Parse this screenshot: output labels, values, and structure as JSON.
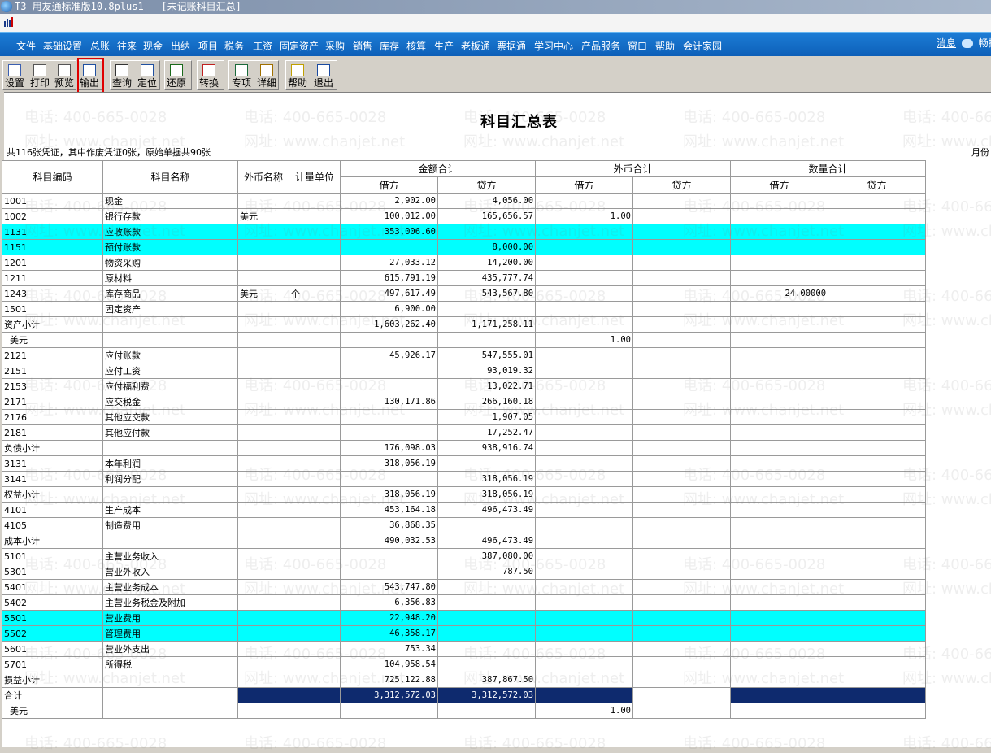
{
  "window": {
    "title": "T3-用友通标准版10.8plus1 - [未记账科目汇总]"
  },
  "menu": [
    "文件",
    "基础设置",
    "总账",
    "往来",
    "现金",
    "出纳",
    "项目",
    "税务",
    "工资",
    "固定资产",
    "采购",
    "销售",
    "库存",
    "核算",
    "生产",
    "老板通",
    "票据通",
    "学习中心",
    "产品服务",
    "窗口",
    "帮助",
    "会计家园"
  ],
  "right_status": {
    "message": "消息",
    "extra": "畅捷"
  },
  "toolbar": [
    {
      "label": "设置",
      "icon": "setup-icon"
    },
    {
      "label": "打印",
      "icon": "print-icon"
    },
    {
      "label": "预览",
      "icon": "preview-icon"
    },
    {
      "label": "输出",
      "icon": "export-icon"
    },
    {
      "label": "查询",
      "icon": "query-icon"
    },
    {
      "label": "定位",
      "icon": "locate-icon"
    },
    {
      "label": "还原",
      "icon": "restore-icon"
    },
    {
      "label": "转换",
      "icon": "convert-icon"
    },
    {
      "label": "专项",
      "icon": "special-icon"
    },
    {
      "label": "详细",
      "icon": "detail-icon"
    },
    {
      "label": "帮助",
      "icon": "help-icon"
    },
    {
      "label": "退出",
      "icon": "exit-icon"
    }
  ],
  "report": {
    "title": "科目汇总表",
    "summary": "共116张凭证，其中作废凭证0张，原始单据共90张",
    "period_label": "月份"
  },
  "watermark": {
    "phone": "电话: 400-665-0028",
    "site": "网址: www.chanjet.net"
  },
  "table": {
    "headers": {
      "code": "科目编码",
      "name": "科目名称",
      "currency": "外币名称",
      "unit": "计量单位",
      "amount_total": "金额合计",
      "fx_total": "外币合计",
      "qty_total": "数量合计",
      "debit": "借方",
      "credit": "贷方"
    },
    "rows": [
      {
        "code": "1001",
        "name": "现金",
        "cur": "",
        "unit": "",
        "dr": "2,902.00",
        "cr": "4,056.00",
        "fdr": "",
        "fcr": "",
        "qdr": "",
        "qcr": "",
        "hl": false
      },
      {
        "code": "1002",
        "name": "银行存款",
        "cur": "美元",
        "unit": "",
        "dr": "100,012.00",
        "cr": "165,656.57",
        "fdr": "1.00",
        "fcr": "",
        "qdr": "",
        "qcr": "",
        "hl": false
      },
      {
        "code": "1131",
        "name": "应收账款",
        "cur": "",
        "unit": "",
        "dr": "353,006.60",
        "cr": "",
        "fdr": "",
        "fcr": "",
        "qdr": "",
        "qcr": "",
        "hl": true
      },
      {
        "code": "1151",
        "name": "预付账款",
        "cur": "",
        "unit": "",
        "dr": "",
        "cr": "8,000.00",
        "fdr": "",
        "fcr": "",
        "qdr": "",
        "qcr": "",
        "hl": true
      },
      {
        "code": "1201",
        "name": "物资采购",
        "cur": "",
        "unit": "",
        "dr": "27,033.12",
        "cr": "14,200.00",
        "fdr": "",
        "fcr": "",
        "qdr": "",
        "qcr": "",
        "hl": false
      },
      {
        "code": "1211",
        "name": "原材料",
        "cur": "",
        "unit": "",
        "dr": "615,791.19",
        "cr": "435,777.74",
        "fdr": "",
        "fcr": "",
        "qdr": "",
        "qcr": "",
        "hl": false
      },
      {
        "code": "1243",
        "name": "库存商品",
        "cur": "美元",
        "unit": "个",
        "dr": "497,617.49",
        "cr": "543,567.80",
        "fdr": "",
        "fcr": "",
        "qdr": "24.00000",
        "qcr": "",
        "hl": false
      },
      {
        "code": "1501",
        "name": "固定资产",
        "cur": "",
        "unit": "",
        "dr": "6,900.00",
        "cr": "",
        "fdr": "",
        "fcr": "",
        "qdr": "",
        "qcr": "",
        "hl": false
      },
      {
        "code": "资产小计",
        "name": "",
        "cur": "",
        "unit": "",
        "dr": "1,603,262.40",
        "cr": "1,171,258.11",
        "fdr": "",
        "fcr": "",
        "qdr": "",
        "qcr": "",
        "hl": false
      },
      {
        "code": "  美元",
        "name": "",
        "cur": "",
        "unit": "",
        "dr": "",
        "cr": "",
        "fdr": "1.00",
        "fcr": "",
        "qdr": "",
        "qcr": "",
        "hl": false
      },
      {
        "code": "2121",
        "name": "应付账款",
        "cur": "",
        "unit": "",
        "dr": "45,926.17",
        "cr": "547,555.01",
        "fdr": "",
        "fcr": "",
        "qdr": "",
        "qcr": "",
        "hl": false
      },
      {
        "code": "2151",
        "name": "应付工资",
        "cur": "",
        "unit": "",
        "dr": "",
        "cr": "93,019.32",
        "fdr": "",
        "fcr": "",
        "qdr": "",
        "qcr": "",
        "hl": false
      },
      {
        "code": "2153",
        "name": "应付福利费",
        "cur": "",
        "unit": "",
        "dr": "",
        "cr": "13,022.71",
        "fdr": "",
        "fcr": "",
        "qdr": "",
        "qcr": "",
        "hl": false
      },
      {
        "code": "2171",
        "name": "应交税金",
        "cur": "",
        "unit": "",
        "dr": "130,171.86",
        "cr": "266,160.18",
        "fdr": "",
        "fcr": "",
        "qdr": "",
        "qcr": "",
        "hl": false
      },
      {
        "code": "2176",
        "name": "其他应交款",
        "cur": "",
        "unit": "",
        "dr": "",
        "cr": "1,907.05",
        "fdr": "",
        "fcr": "",
        "qdr": "",
        "qcr": "",
        "hl": false
      },
      {
        "code": "2181",
        "name": "其他应付款",
        "cur": "",
        "unit": "",
        "dr": "",
        "cr": "17,252.47",
        "fdr": "",
        "fcr": "",
        "qdr": "",
        "qcr": "",
        "hl": false
      },
      {
        "code": "负债小计",
        "name": "",
        "cur": "",
        "unit": "",
        "dr": "176,098.03",
        "cr": "938,916.74",
        "fdr": "",
        "fcr": "",
        "qdr": "",
        "qcr": "",
        "hl": false
      },
      {
        "code": "3131",
        "name": "本年利润",
        "cur": "",
        "unit": "",
        "dr": "318,056.19",
        "cr": "",
        "fdr": "",
        "fcr": "",
        "qdr": "",
        "qcr": "",
        "hl": false
      },
      {
        "code": "3141",
        "name": "利润分配",
        "cur": "",
        "unit": "",
        "dr": "",
        "cr": "318,056.19",
        "fdr": "",
        "fcr": "",
        "qdr": "",
        "qcr": "",
        "hl": false
      },
      {
        "code": "权益小计",
        "name": "",
        "cur": "",
        "unit": "",
        "dr": "318,056.19",
        "cr": "318,056.19",
        "fdr": "",
        "fcr": "",
        "qdr": "",
        "qcr": "",
        "hl": false
      },
      {
        "code": "4101",
        "name": "生产成本",
        "cur": "",
        "unit": "",
        "dr": "453,164.18",
        "cr": "496,473.49",
        "fdr": "",
        "fcr": "",
        "qdr": "",
        "qcr": "",
        "hl": false
      },
      {
        "code": "4105",
        "name": "制造费用",
        "cur": "",
        "unit": "",
        "dr": "36,868.35",
        "cr": "",
        "fdr": "",
        "fcr": "",
        "qdr": "",
        "qcr": "",
        "hl": false
      },
      {
        "code": "成本小计",
        "name": "",
        "cur": "",
        "unit": "",
        "dr": "490,032.53",
        "cr": "496,473.49",
        "fdr": "",
        "fcr": "",
        "qdr": "",
        "qcr": "",
        "hl": false
      },
      {
        "code": "5101",
        "name": "主营业务收入",
        "cur": "",
        "unit": "",
        "dr": "",
        "cr": "387,080.00",
        "fdr": "",
        "fcr": "",
        "qdr": "",
        "qcr": "",
        "hl": false
      },
      {
        "code": "5301",
        "name": "营业外收入",
        "cur": "",
        "unit": "",
        "dr": "",
        "cr": "787.50",
        "fdr": "",
        "fcr": "",
        "qdr": "",
        "qcr": "",
        "hl": false
      },
      {
        "code": "5401",
        "name": "主营业务成本",
        "cur": "",
        "unit": "",
        "dr": "543,747.80",
        "cr": "",
        "fdr": "",
        "fcr": "",
        "qdr": "",
        "qcr": "",
        "hl": false
      },
      {
        "code": "5402",
        "name": "主营业务税金及附加",
        "cur": "",
        "unit": "",
        "dr": "6,356.83",
        "cr": "",
        "fdr": "",
        "fcr": "",
        "qdr": "",
        "qcr": "",
        "hl": false
      },
      {
        "code": "5501",
        "name": "营业费用",
        "cur": "",
        "unit": "",
        "dr": "22,948.20",
        "cr": "",
        "fdr": "",
        "fcr": "",
        "qdr": "",
        "qcr": "",
        "hl": true
      },
      {
        "code": "5502",
        "name": "管理费用",
        "cur": "",
        "unit": "",
        "dr": "46,358.17",
        "cr": "",
        "fdr": "",
        "fcr": "",
        "qdr": "",
        "qcr": "",
        "hl": true
      },
      {
        "code": "5601",
        "name": "营业外支出",
        "cur": "",
        "unit": "",
        "dr": "753.34",
        "cr": "",
        "fdr": "",
        "fcr": "",
        "qdr": "",
        "qcr": "",
        "hl": false
      },
      {
        "code": "5701",
        "name": "所得税",
        "cur": "",
        "unit": "",
        "dr": "104,958.54",
        "cr": "",
        "fdr": "",
        "fcr": "",
        "qdr": "",
        "qcr": "",
        "hl": false
      },
      {
        "code": "损益小计",
        "name": "",
        "cur": "",
        "unit": "",
        "dr": "725,122.88",
        "cr": "387,867.50",
        "fdr": "",
        "fcr": "",
        "qdr": "",
        "qcr": "",
        "hl": false
      },
      {
        "code": "合计",
        "name": "",
        "cur": "",
        "unit": "",
        "dr": "3,312,572.03",
        "cr": "3,312,572.03",
        "fdr": "",
        "fcr": "",
        "qdr": "",
        "qcr": "",
        "hl": false,
        "total": true
      },
      {
        "code": "  美元",
        "name": "",
        "cur": "",
        "unit": "",
        "dr": "",
        "cr": "",
        "fdr": "1.00",
        "fcr": "",
        "qdr": "",
        "qcr": "",
        "hl": false
      }
    ]
  }
}
